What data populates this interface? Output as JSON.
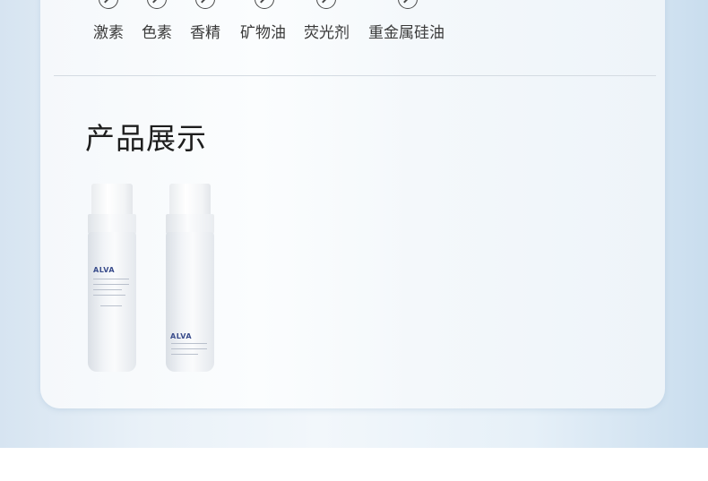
{
  "features": {
    "items": [
      {
        "label": "激素"
      },
      {
        "label": "色素"
      },
      {
        "label": "香精"
      },
      {
        "label": "矿物油"
      },
      {
        "label": "荧光剂"
      },
      {
        "label": "重金属硅油"
      }
    ]
  },
  "section": {
    "title": "产品展示"
  },
  "products": [
    {
      "brand": "ALVA"
    },
    {
      "brand": "ALVA"
    }
  ],
  "colors": {
    "text": "#3a3a3a",
    "title": "#1e1e1e",
    "brand": "#3a4d8c",
    "background_accent": "#c9ddee"
  }
}
